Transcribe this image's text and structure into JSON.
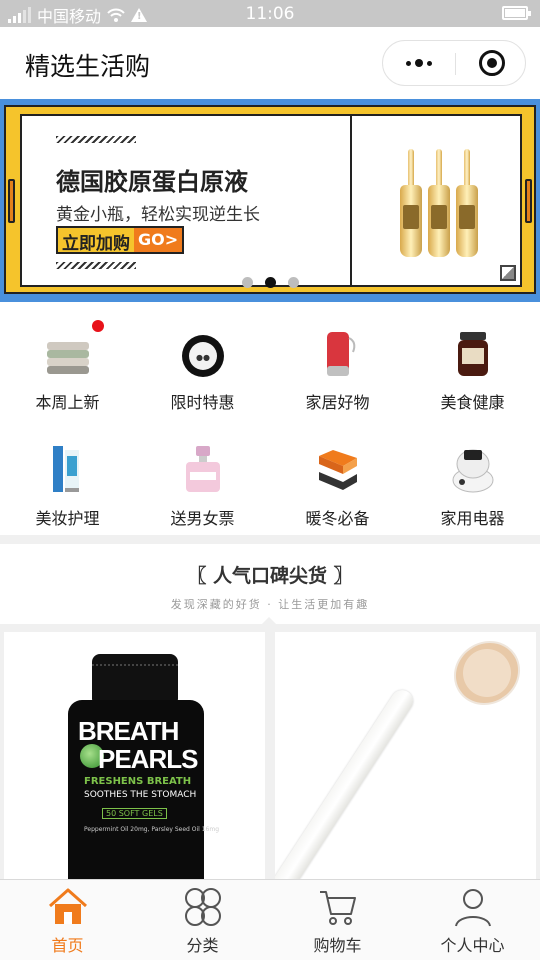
{
  "status_bar": {
    "carrier": "中国移动",
    "time": "11:06"
  },
  "nav": {
    "title": "精选生活购"
  },
  "banner": {
    "title": "德国胶原蛋白原液",
    "subtitle": "黄金小瓶，轻松实现逆生长",
    "button_cn": "立即加购",
    "button_go": "GO>",
    "slide_count": 3,
    "active_slide": 2
  },
  "categories": [
    {
      "label": "本周上新",
      "icon": "towels-icon",
      "badge": true
    },
    {
      "label": "限时特惠",
      "icon": "compact-powder-icon",
      "badge": false
    },
    {
      "label": "家居好物",
      "icon": "speaker-icon",
      "badge": false
    },
    {
      "label": "美食健康",
      "icon": "jar-icon",
      "badge": false
    },
    {
      "label": "美妆护理",
      "icon": "skincare-tube-icon",
      "badge": false
    },
    {
      "label": "送男女票",
      "icon": "perfume-icon",
      "badge": false
    },
    {
      "label": "暖冬必备",
      "icon": "folded-clothes-icon",
      "badge": false
    },
    {
      "label": "家用电器",
      "icon": "steamer-icon",
      "badge": false
    }
  ],
  "section": {
    "title": "〖 人气口碑尖货 〗",
    "subtitle": "发现深藏的好货 · 让生活更加有趣"
  },
  "products": [
    {
      "brand_line1": "BREATH",
      "brand_line2": "PEARLS",
      "line3": "FRESHENS BREATH",
      "line4": "SOOTHES THE STOMACH",
      "badge": "50 SOFT GELS",
      "fine_print": "Peppermint Oil 20mg, Parsley Seed Oil 16mg"
    },
    {
      "image": "bath-brush"
    }
  ],
  "tabs": [
    {
      "label": "首页",
      "icon": "home-icon",
      "active": true
    },
    {
      "label": "分类",
      "icon": "category-icon",
      "active": false
    },
    {
      "label": "购物车",
      "icon": "cart-icon",
      "active": false
    },
    {
      "label": "个人中心",
      "icon": "user-icon",
      "active": false
    }
  ],
  "colors": {
    "accent": "#f07b1c",
    "banner_bg": "#4a90dc",
    "banner_frame": "#f5c42c",
    "badge_red": "#e8121a"
  }
}
